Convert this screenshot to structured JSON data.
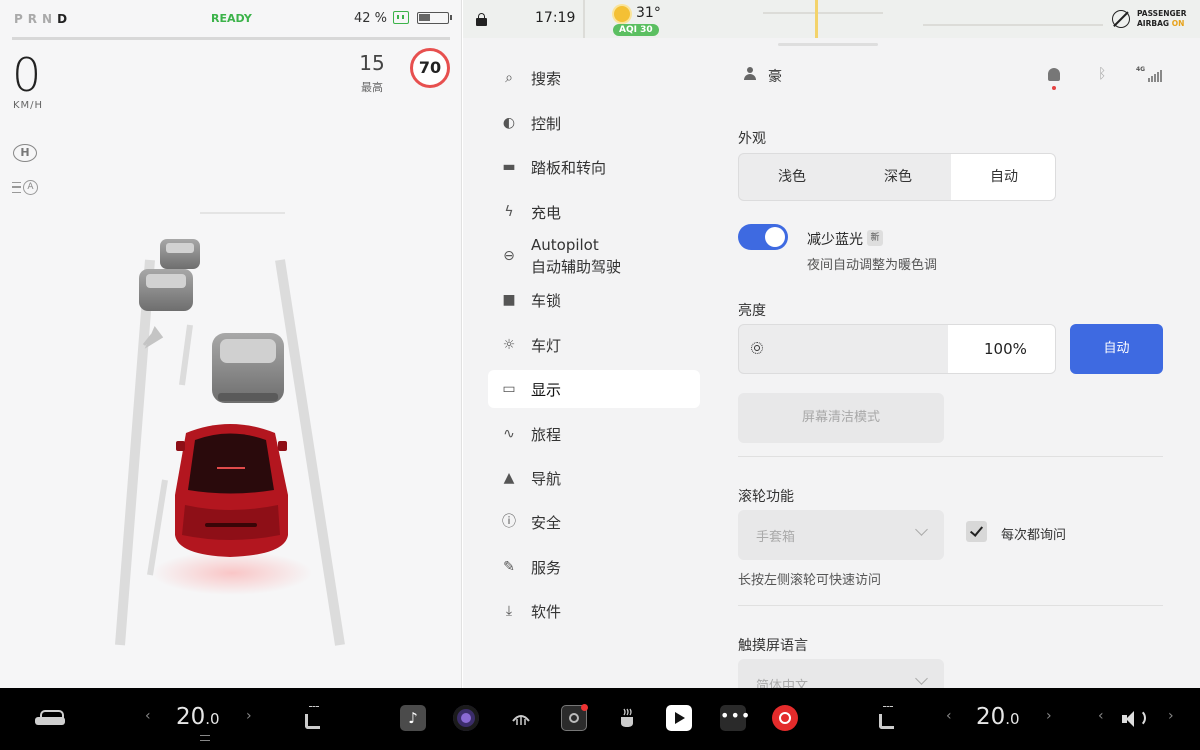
{
  "status_bar": {
    "gears": [
      "P",
      "R",
      "N"
    ],
    "gear_active": "D",
    "ready": "READY",
    "battery_percent": "42 %",
    "battery_level": 0.42
  },
  "driving": {
    "speed": "0",
    "speed_unit": "KM/H",
    "max_speed": "15",
    "max_label": "最高",
    "speed_limit": "70",
    "hold_icon": "H",
    "auto_beam_icon": "A"
  },
  "top_strip": {
    "time": "17:19",
    "temperature": "31°",
    "aqi": "AQI 30",
    "airbag_line1": "PASSENGER",
    "airbag_line2": "AIRBAG",
    "airbag_status": "ON"
  },
  "menu": {
    "items": [
      {
        "label": "搜索",
        "icon": "search-icon"
      },
      {
        "label": "控制",
        "icon": "toggle-icon"
      },
      {
        "label": "踏板和转向",
        "icon": "car-icon"
      },
      {
        "label": "充电",
        "icon": "bolt-icon"
      },
      {
        "label": "Autopilot",
        "label2": "自动辅助驾驶",
        "icon": "steering-wheel-icon"
      },
      {
        "label": "车锁",
        "icon": "lock-icon"
      },
      {
        "label": "车灯",
        "icon": "light-icon"
      },
      {
        "label": "显示",
        "icon": "display-icon",
        "active": true
      },
      {
        "label": "旅程",
        "icon": "trips-icon"
      },
      {
        "label": "导航",
        "icon": "navigate-icon"
      },
      {
        "label": "安全",
        "icon": "alert-icon"
      },
      {
        "label": "服务",
        "icon": "wrench-icon"
      },
      {
        "label": "软件",
        "icon": "download-icon"
      }
    ]
  },
  "profile": {
    "name": "豪",
    "signal": "4G"
  },
  "display": {
    "appearance_title": "外观",
    "appearance_options": [
      "浅色",
      "深色",
      "自动"
    ],
    "appearance_selected": "自动",
    "blue_light_label": "减少蓝光",
    "blue_light_badge": "新",
    "blue_light_sub": "夜间自动调整为暖色调",
    "blue_light_on": true,
    "brightness_title": "亮度",
    "brightness_value": "100%",
    "brightness_auto": "自动",
    "clean_mode": "屏幕清洁模式",
    "scroll_title": "滚轮功能",
    "scroll_value": "手套箱",
    "scroll_ask": "每次都询问",
    "scroll_hint": "长按左侧滚轮可快速访问",
    "language_title": "触摸屏语言",
    "language_value": "简体中文"
  },
  "bottom_bar": {
    "left_temp": "20",
    "left_temp_dec": ".0",
    "right_temp": "20",
    "right_temp_dec": ".0",
    "arrow_left": "‹",
    "arrow_right": "›",
    "music_glyph": "♪",
    "more_glyph": "•••"
  },
  "colors": {
    "accent": "#3e6ae1",
    "ready": "#3cb34a",
    "limit_ring": "#e7504f",
    "car_red": "#b3161f"
  }
}
